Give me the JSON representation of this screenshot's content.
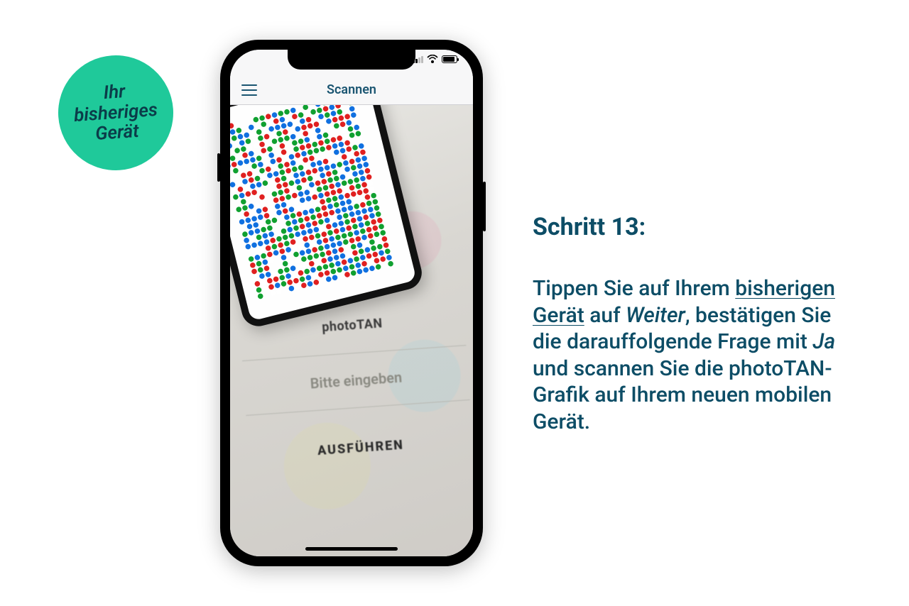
{
  "badge": {
    "line1": "Ihr",
    "line2": "bisheriges",
    "line3": "Gerät"
  },
  "instructions": {
    "heading": "Schritt 13:",
    "body_pre": "Tippen Sie auf Ihrem ",
    "underscored": "bisherigen Gerät",
    "body_mid1": " auf ",
    "italic1": "Weiter",
    "body_mid2": ", bestätigen Sie die darauffolgende Frage mit ",
    "italic2": "Ja",
    "body_post": " und scannen Sie die photoTAN-Grafik auf Ihrem neuen mobilen Gerät."
  },
  "phone": {
    "appbar_title": "Scannen",
    "form_label": "photoTAN",
    "form_placeholder": "Bitte eingeben",
    "form_button": "AUSFÜHREN"
  },
  "dotgrid": {
    "size": 22,
    "cell": 9
  }
}
